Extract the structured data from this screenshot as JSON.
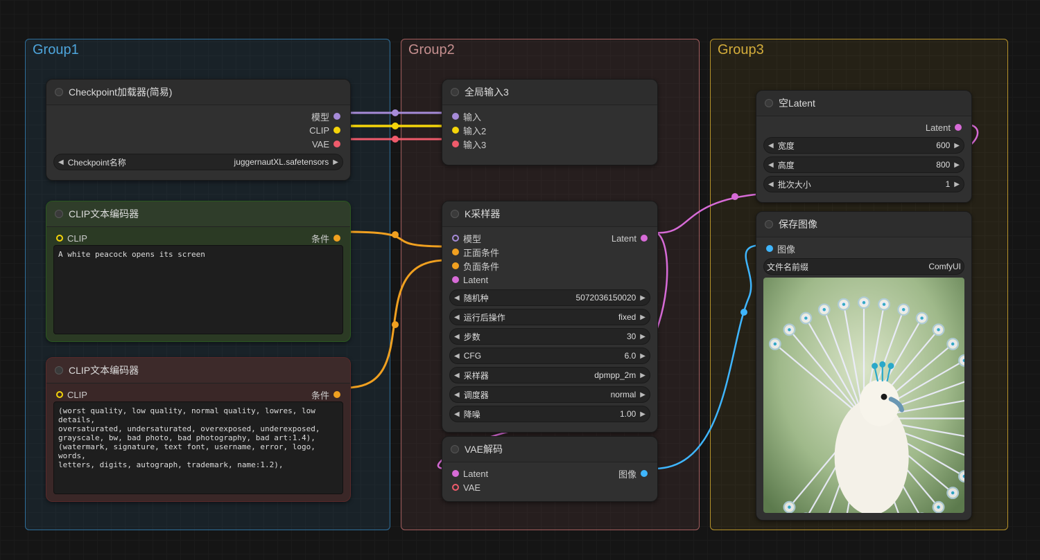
{
  "groups": {
    "g1": {
      "title": "Group1"
    },
    "g2": {
      "title": "Group2"
    },
    "g3": {
      "title": "Group3"
    }
  },
  "nodes": {
    "ckpt": {
      "title": "Checkpoint加载器(简易)",
      "outs": {
        "model": "模型",
        "clip": "CLIP",
        "vae": "VAE"
      },
      "param": {
        "label": "Checkpoint名称",
        "value": "juggernautXL.safetensors"
      }
    },
    "clip_pos": {
      "title": "CLIP文本编码器",
      "in": "CLIP",
      "out": "条件",
      "text": "A white peacock opens its screen"
    },
    "clip_neg": {
      "title": "CLIP文本编码器",
      "in": "CLIP",
      "out": "条件",
      "text": "(worst quality, low quality, normal quality, lowres, low details,\noversaturated, undersaturated, overexposed, underexposed,\ngrayscale, bw, bad photo, bad photography, bad art:1.4),\n(watermark, signature, text font, username, error, logo, words,\nletters, digits, autograph, trademark, name:1.2),"
    },
    "global_in": {
      "title": "全局输入3",
      "ins": {
        "a": "输入",
        "b": "输入2",
        "c": "输入3"
      }
    },
    "ksampler": {
      "title": "K采样器",
      "ins": {
        "model": "模型",
        "pos": "正面条件",
        "neg": "负面条件",
        "latent": "Latent"
      },
      "out": "Latent",
      "params": [
        {
          "label": "随机种",
          "value": "5072036150020"
        },
        {
          "label": "运行后操作",
          "value": "fixed"
        },
        {
          "label": "步数",
          "value": "30"
        },
        {
          "label": "CFG",
          "value": "6.0"
        },
        {
          "label": "采样器",
          "value": "dpmpp_2m"
        },
        {
          "label": "调度器",
          "value": "normal"
        },
        {
          "label": "降噪",
          "value": "1.00"
        }
      ]
    },
    "vae_dec": {
      "title": "VAE解码",
      "ins": {
        "latent": "Latent",
        "vae": "VAE"
      },
      "out": "图像"
    },
    "empty_latent": {
      "title": "空Latent",
      "out": "Latent",
      "params": [
        {
          "label": "宽度",
          "value": "600"
        },
        {
          "label": "高度",
          "value": "800"
        },
        {
          "label": "批次大小",
          "value": "1"
        }
      ]
    },
    "save_image": {
      "title": "保存图像",
      "in": "图像",
      "param": {
        "label": "文件名前缀",
        "value": "ComfyUI"
      }
    }
  }
}
